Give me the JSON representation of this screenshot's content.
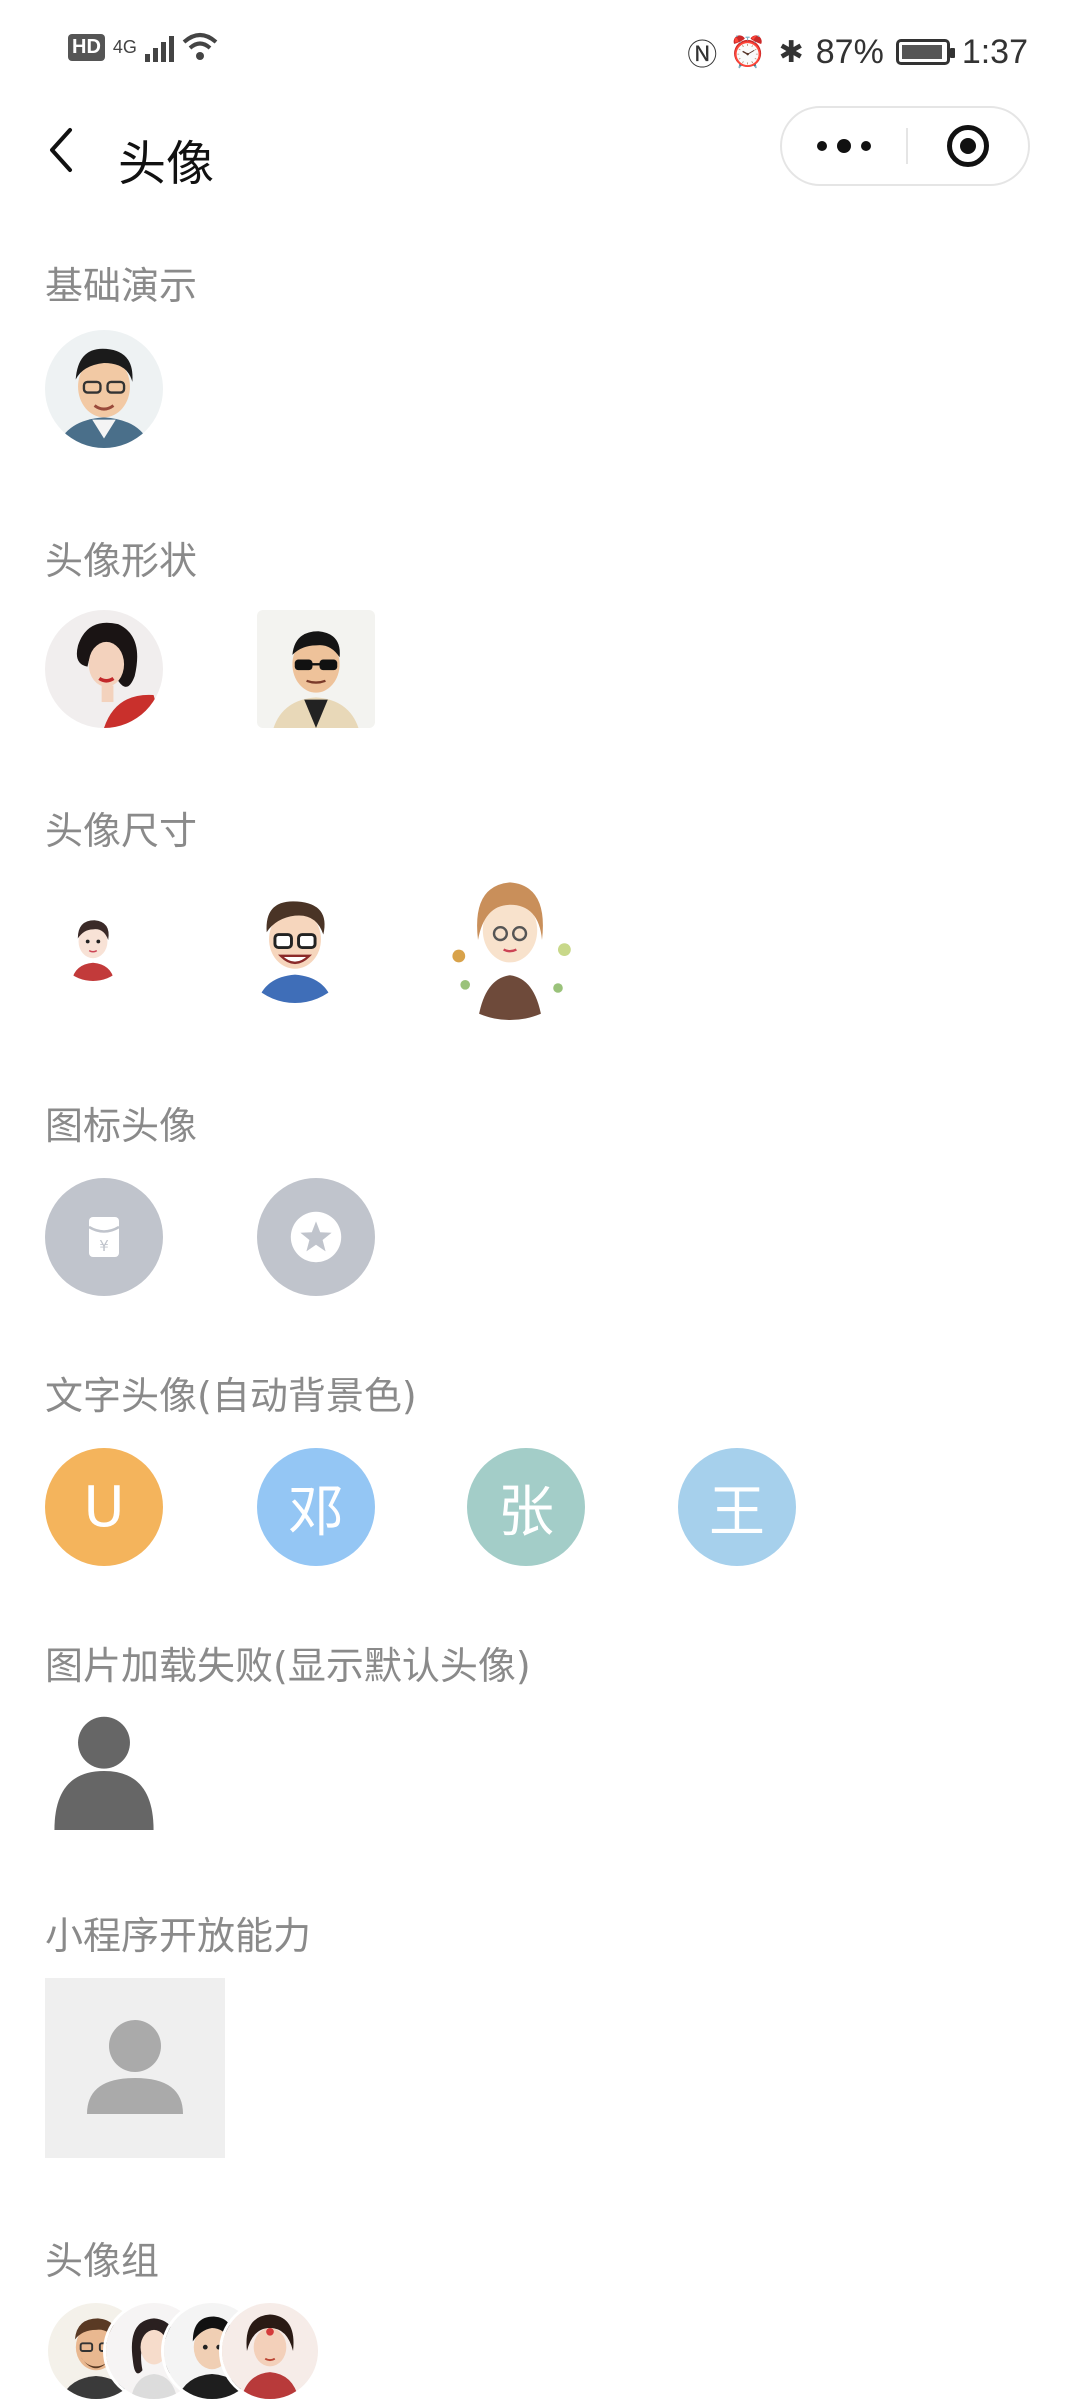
{
  "status_bar": {
    "hd": "HD",
    "network": "4G",
    "battery_percent": "87%",
    "time": "1:37"
  },
  "nav": {
    "title": "头像"
  },
  "sections": {
    "basic": {
      "title": "基础演示"
    },
    "shape": {
      "title": "头像形状"
    },
    "size": {
      "title": "头像尺寸"
    },
    "icon": {
      "title": "图标头像"
    },
    "text": {
      "title": "文字头像(自动背景色)",
      "avatars": [
        {
          "text": "U",
          "color": "#f4b45c"
        },
        {
          "text": "邓",
          "color": "#94c6f4"
        },
        {
          "text": "张",
          "color": "#a3cdc8"
        },
        {
          "text": "王",
          "color": "#a6d0ec"
        }
      ]
    },
    "failed": {
      "title": "图片加载失败(显示默认头像)"
    },
    "miniprogram": {
      "title": "小程序开放能力"
    },
    "group": {
      "title": "头像组"
    }
  },
  "colors": {
    "section_title": "#8a8a8a",
    "icon_avatar_bg": "#c0c4cc",
    "default_avatar": "#666666"
  },
  "icons": [
    "back-icon",
    "more-icon",
    "close-target-icon",
    "red-envelope-icon",
    "star-icon",
    "default-user-icon"
  ]
}
